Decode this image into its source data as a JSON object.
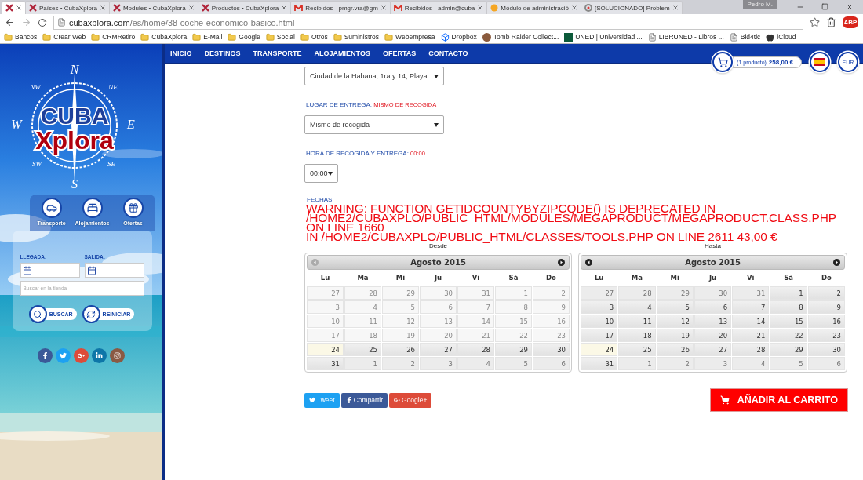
{
  "browser": {
    "tabs": [
      {
        "kind": "x",
        "selected": true
      },
      {
        "title": "Países • CubaXplora",
        "kind": "x",
        "selected": false
      },
      {
        "title": "Modules • CubaXplora",
        "kind": "x",
        "selected": false
      },
      {
        "title": "Productos • CubaXplora",
        "kind": "x",
        "selected": false
      },
      {
        "title": "Recibidos - pmgr.vra@gm",
        "kind": "gmail",
        "selected": false
      },
      {
        "title": "Recibidos - admin@cuba",
        "kind": "gmail",
        "selected": false
      },
      {
        "title": "Módulo de administració",
        "kind": "orange",
        "selected": false
      },
      {
        "title": "[SOLUCIONADO] Problem",
        "kind": "forum",
        "selected": false
      }
    ],
    "profile": "Pedro M.",
    "url_host": "cubaxplora.com",
    "url_path": "/es/home/38-coche-economico-basico.html",
    "extension": "ABP",
    "bookmarks": [
      {
        "label": "Bancos",
        "kind": "folder"
      },
      {
        "label": "Crear Web",
        "kind": "folder"
      },
      {
        "label": "CRMRetiro",
        "kind": "folder"
      },
      {
        "label": "CubaXplora",
        "kind": "folder"
      },
      {
        "label": "E-Mail",
        "kind": "folder"
      },
      {
        "label": "Google",
        "kind": "folder"
      },
      {
        "label": "Social",
        "kind": "folder"
      },
      {
        "label": "Otros",
        "kind": "folder"
      },
      {
        "label": "Suministros",
        "kind": "folder"
      },
      {
        "label": "Webempresa",
        "kind": "folder"
      },
      {
        "label": "Dropbox",
        "kind": "dropbox"
      },
      {
        "label": "Tomb Raider Collect...",
        "kind": "avatar"
      },
      {
        "label": "UNED | Universidad ...",
        "kind": "uned"
      },
      {
        "label": "LIBRUNED - Libros ...",
        "kind": "page"
      },
      {
        "label": "Bid4tic",
        "kind": "page"
      },
      {
        "label": "iCloud",
        "kind": "apple"
      }
    ]
  },
  "sidebar": {
    "logo": {
      "top": "CUBA",
      "bottom": "Xplora",
      "compass": [
        "N",
        "NE",
        "E",
        "SE",
        "S",
        "SW",
        "W",
        "NW"
      ]
    },
    "categories": [
      {
        "label": "Transporte",
        "kind": "car"
      },
      {
        "label": "Alojamientos",
        "kind": "bed"
      },
      {
        "label": "Ofertas",
        "kind": "gift"
      }
    ],
    "arrival_label": "LLEGADA:",
    "departure_label": "SALIDA:",
    "search_placeholder": "Buscar en la tienda",
    "buttons": [
      {
        "label": "BUSCAR",
        "kind": "search"
      },
      {
        "label": "REINICIAR",
        "kind": "reset"
      }
    ],
    "social": [
      {
        "kind": "facebook"
      },
      {
        "kind": "twitter"
      },
      {
        "kind": "googleplus"
      },
      {
        "kind": "linkedin"
      },
      {
        "kind": "instagram"
      }
    ]
  },
  "nav": [
    "INICIO",
    "DESTINOS",
    "TRANSPORTE",
    "ALOJAMIENTOS",
    "OFERTAS",
    "CONTACTO"
  ],
  "cart": {
    "count": "(1 producto)",
    "total": "258,00 €",
    "currency": "EUR"
  },
  "form": {
    "pickup_select": "Ciudad de la Habana, 1ra y 14, Playa",
    "delivery_label": "LUGAR DE ENTREGA:",
    "delivery_value": "MISMO DE RECOGIDA",
    "delivery_select": "Mismo de recogida",
    "time_label": "HORA DE RECOGIDA Y ENTREGA:",
    "time_value": "00:00",
    "time_select": "00:00",
    "dates_label": "FECHAS",
    "warning": [
      "WARNING: FUNCTION GETIDCOUNTYBYZIPCODE() IS DEPRECATED IN",
      "/HOME2/CUBAXPLO/PUBLIC_HTML/MODULES/MEGAPRODUCT/MEGAPRODUCT.CLASS.PHP",
      "ON LINE 1660",
      "IN /HOME2/CUBAXPLO/PUBLIC_HTML/CLASSES/TOOLS.PHP ON LINE 2611 43,00 €"
    ]
  },
  "calendars": [
    {
      "label": "Desde",
      "month": "Agosto 2015",
      "prev": {
        "disabled": true
      },
      "next": {
        "disabled": false
      },
      "weekdays": [
        "Lu",
        "Ma",
        "Mi",
        "Ju",
        "Vi",
        "Sá",
        "Do"
      ],
      "weeks": [
        [
          {
            "d": "27",
            "kind": "off"
          },
          {
            "d": "28",
            "kind": "off"
          },
          {
            "d": "29",
            "kind": "off"
          },
          {
            "d": "30",
            "kind": "off"
          },
          {
            "d": "31",
            "kind": "off"
          },
          {
            "d": "1",
            "kind": "off"
          },
          {
            "d": "2",
            "kind": "off"
          }
        ],
        [
          {
            "d": "3",
            "kind": "off"
          },
          {
            "d": "4",
            "kind": "off"
          },
          {
            "d": "5",
            "kind": "off"
          },
          {
            "d": "6",
            "kind": "off"
          },
          {
            "d": "7",
            "kind": "off"
          },
          {
            "d": "8",
            "kind": "off"
          },
          {
            "d": "9",
            "kind": "off"
          }
        ],
        [
          {
            "d": "10",
            "kind": "off"
          },
          {
            "d": "11",
            "kind": "off"
          },
          {
            "d": "12",
            "kind": "off"
          },
          {
            "d": "13",
            "kind": "off"
          },
          {
            "d": "14",
            "kind": "off"
          },
          {
            "d": "15",
            "kind": "off"
          },
          {
            "d": "16",
            "kind": "off"
          }
        ],
        [
          {
            "d": "17",
            "kind": "off"
          },
          {
            "d": "18",
            "kind": "off"
          },
          {
            "d": "19",
            "kind": "off"
          },
          {
            "d": "20",
            "kind": "off"
          },
          {
            "d": "21",
            "kind": "off"
          },
          {
            "d": "22",
            "kind": "off"
          },
          {
            "d": "23",
            "kind": "off"
          }
        ],
        [
          {
            "d": "24",
            "kind": "today"
          },
          {
            "d": "25",
            "kind": "on"
          },
          {
            "d": "26",
            "kind": "on"
          },
          {
            "d": "27",
            "kind": "on"
          },
          {
            "d": "28",
            "kind": "on"
          },
          {
            "d": "29",
            "kind": "on"
          },
          {
            "d": "30",
            "kind": "on"
          }
        ],
        [
          {
            "d": "31",
            "kind": "on"
          },
          {
            "d": "1",
            "kind": "other"
          },
          {
            "d": "2",
            "kind": "other"
          },
          {
            "d": "3",
            "kind": "other"
          },
          {
            "d": "4",
            "kind": "other"
          },
          {
            "d": "5",
            "kind": "other"
          },
          {
            "d": "6",
            "kind": "other"
          }
        ]
      ]
    },
    {
      "label": "Hasta",
      "month": "Agosto 2015",
      "prev": {
        "disabled": false
      },
      "next": {
        "disabled": false
      },
      "weekdays": [
        "Lu",
        "Ma",
        "Mi",
        "Ju",
        "Vi",
        "Sá",
        "Do"
      ],
      "weeks": [
        [
          {
            "d": "27",
            "kind": "other"
          },
          {
            "d": "28",
            "kind": "other"
          },
          {
            "d": "29",
            "kind": "other"
          },
          {
            "d": "30",
            "kind": "other"
          },
          {
            "d": "31",
            "kind": "other"
          },
          {
            "d": "1",
            "kind": "on"
          },
          {
            "d": "2",
            "kind": "on"
          }
        ],
        [
          {
            "d": "3",
            "kind": "on"
          },
          {
            "d": "4",
            "kind": "on"
          },
          {
            "d": "5",
            "kind": "on"
          },
          {
            "d": "6",
            "kind": "on"
          },
          {
            "d": "7",
            "kind": "on"
          },
          {
            "d": "8",
            "kind": "on"
          },
          {
            "d": "9",
            "kind": "on"
          }
        ],
        [
          {
            "d": "10",
            "kind": "on"
          },
          {
            "d": "11",
            "kind": "on"
          },
          {
            "d": "12",
            "kind": "on"
          },
          {
            "d": "13",
            "kind": "on"
          },
          {
            "d": "14",
            "kind": "on"
          },
          {
            "d": "15",
            "kind": "on"
          },
          {
            "d": "16",
            "kind": "on"
          }
        ],
        [
          {
            "d": "17",
            "kind": "on"
          },
          {
            "d": "18",
            "kind": "on"
          },
          {
            "d": "19",
            "kind": "on"
          },
          {
            "d": "20",
            "kind": "on"
          },
          {
            "d": "21",
            "kind": "on"
          },
          {
            "d": "22",
            "kind": "on"
          },
          {
            "d": "23",
            "kind": "on"
          }
        ],
        [
          {
            "d": "24",
            "kind": "today"
          },
          {
            "d": "25",
            "kind": "on"
          },
          {
            "d": "26",
            "kind": "on"
          },
          {
            "d": "27",
            "kind": "on"
          },
          {
            "d": "28",
            "kind": "on"
          },
          {
            "d": "29",
            "kind": "on"
          },
          {
            "d": "30",
            "kind": "on"
          }
        ],
        [
          {
            "d": "31",
            "kind": "on"
          },
          {
            "d": "1",
            "kind": "other"
          },
          {
            "d": "2",
            "kind": "other"
          },
          {
            "d": "3",
            "kind": "other"
          },
          {
            "d": "4",
            "kind": "other"
          },
          {
            "d": "5",
            "kind": "other"
          },
          {
            "d": "6",
            "kind": "other"
          }
        ]
      ]
    }
  ],
  "share": [
    {
      "label": "Tweet",
      "kind": "twitter"
    },
    {
      "label": "Compartir",
      "kind": "facebook"
    },
    {
      "label": "Google+",
      "kind": "googleplus"
    }
  ],
  "add_to_cart": "AÑADIR AL CARRITO"
}
